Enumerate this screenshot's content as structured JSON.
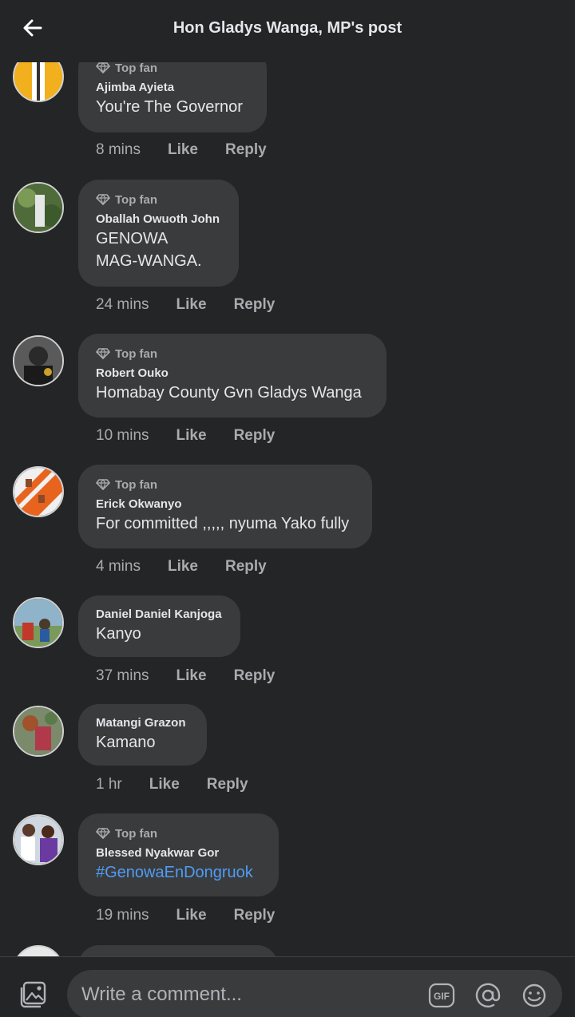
{
  "header": {
    "title": "Hon Gladys Wanga, MP's post",
    "back_icon": "arrow-left-icon"
  },
  "comments": [
    {
      "badge": "Top fan",
      "author": "Ajimba Ayieta",
      "text": "You're The Governor",
      "time": "8 mins",
      "like": "Like",
      "reply": "Reply"
    },
    {
      "badge": "Top fan",
      "author": "Oballah Owuoth John",
      "text": "GENOWA\nMAG-WANGA.",
      "time": "24 mins",
      "like": "Like",
      "reply": "Reply"
    },
    {
      "badge": "Top fan",
      "author": "Robert Ouko",
      "text": "Homabay County Gvn Gladys Wanga",
      "time": "10 mins",
      "like": "Like",
      "reply": "Reply"
    },
    {
      "badge": "Top fan",
      "author": "Erick Okwanyo",
      "text": "For committed ,,,,, nyuma Yako fully",
      "time": "4 mins",
      "like": "Like",
      "reply": "Reply"
    },
    {
      "badge": "",
      "author": "Daniel Daniel Kanjoga",
      "text": "Kanyo",
      "time": "37 mins",
      "like": "Like",
      "reply": "Reply"
    },
    {
      "badge": "",
      "author": "Matangi Grazon",
      "text": "Kamano",
      "time": "1 hr",
      "like": "Like",
      "reply": "Reply"
    },
    {
      "badge": "Top fan",
      "author": "Blessed Nyakwar Gor",
      "text": "#GenowaEnDongruok",
      "time": "19 mins",
      "like": "Like",
      "reply": "Reply"
    }
  ],
  "composer": {
    "placeholder": "Write a comment...",
    "photo_icon": "photo-icon",
    "gif_label": "GIF",
    "mention_icon": "at-icon",
    "emoji_icon": "smiley-icon"
  },
  "colors": {
    "background": "#242526",
    "bubble": "#3a3b3c",
    "text": "#e4e6eb",
    "muted": "#a8abaf",
    "hashtag": "#4f9cf5"
  }
}
